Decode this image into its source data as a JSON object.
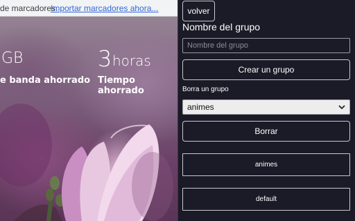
{
  "newtab": {
    "bookmarks_text": "de marcadores.",
    "import_link": "Importar marcadores ahora...",
    "bandwidth_value": "GB",
    "bandwidth_label": "e banda ahorrado",
    "time_value": "3",
    "time_unit": "horas",
    "time_label": "Tiempo ahorrado"
  },
  "popup": {
    "back_label": "volver",
    "group_name_title": "Nombre del grupo",
    "group_name_input": {
      "value": "",
      "placeholder": "Nombre del grupo"
    },
    "create_label": "Crear un grupo",
    "delete_title": "Borra un grupo",
    "select_value": "animes",
    "delete_label": "Borrar",
    "groups": [
      {
        "label": "animes"
      },
      {
        "label": "default"
      }
    ]
  },
  "colors": {
    "panel_bg": "#1b1a27",
    "button_border": "#c9c9cf",
    "text": "#ffffff"
  }
}
